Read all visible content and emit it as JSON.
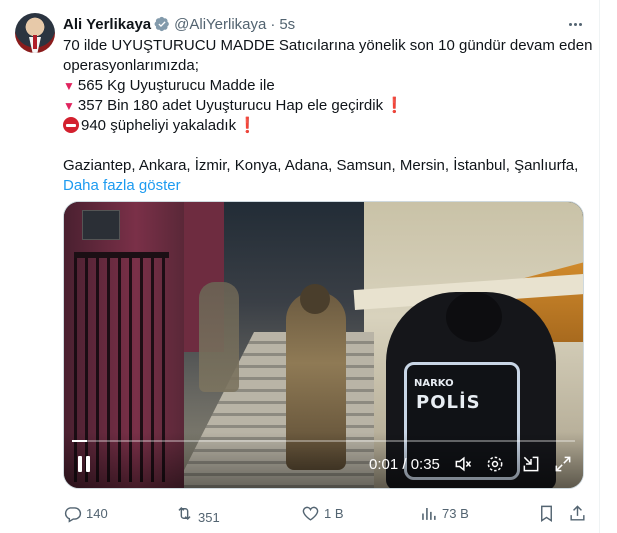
{
  "author": {
    "name": "Ali Yerlikaya",
    "handle": "@AliYerlikaya",
    "separator": "·",
    "time": "5s",
    "verified_icon": "verified-badge-icon",
    "badge_color": "#829aab"
  },
  "tweet": {
    "line1": "70 ilde UYUŞTURUCU MADDE Satıcılarına yönelik son 10 gündür devam eden",
    "line2": "operasyonlarımızda;",
    "line3": "565 Kg Uyuşturucu Madde ile",
    "line4": "357 Bin 180 adet Uyuşturucu Hap ele geçirdik",
    "line5": "940 şüpheliyi yakaladık",
    "line6": "Gaziantep, Ankara, İzmir, Konya, Adana, Samsun, Mersin, İstanbul, Şanlıurfa,",
    "show_more": "Daha fazla göster",
    "triangle_glyph": "▼",
    "exclamation_glyph": "❗",
    "link_color": "#1d9bf0"
  },
  "media": {
    "vest_small": "NARKO",
    "vest_big": "POLİS",
    "progress_fraction": 0.03,
    "timecode": "0:01 / 0:35",
    "icons": [
      "pause-icon",
      "mute-icon",
      "settings-icon",
      "pip-icon",
      "fullscreen-icon"
    ]
  },
  "actions": {
    "replies": "140",
    "reposts": "351",
    "likes": "1 B",
    "views": "73 B",
    "icons": [
      "reply-icon",
      "repost-icon",
      "like-icon",
      "views-icon",
      "bookmark-icon",
      "share-icon"
    ]
  }
}
